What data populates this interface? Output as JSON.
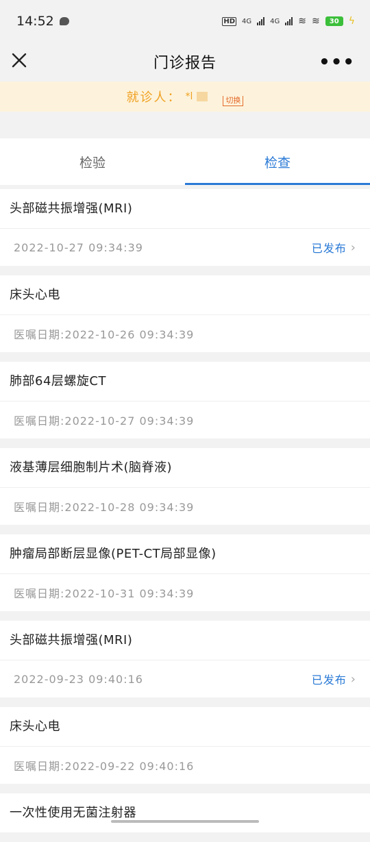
{
  "status_bar": {
    "time": "14:52",
    "hd_label": "HD",
    "net1": "4G",
    "net2": "4G",
    "battery": "30"
  },
  "nav": {
    "title": "门诊报告"
  },
  "patient": {
    "label": "就诊人：",
    "name": "*l",
    "switch_label": "切换"
  },
  "tabs": [
    {
      "label": "检验",
      "active": false
    },
    {
      "label": "检查",
      "active": true
    }
  ],
  "reports": [
    {
      "title": "头部磁共振增强(MRI)",
      "meta": "2022-10-27 09:34:39",
      "status": "已发布"
    },
    {
      "title": "床头心电",
      "meta": "医嘱日期:2022-10-26 09:34:39",
      "status": ""
    },
    {
      "title": "肺部64层螺旋CT",
      "meta": "医嘱日期:2022-10-27 09:34:39",
      "status": ""
    },
    {
      "title": "液基薄层细胞制片术(脑脊液)",
      "meta": "医嘱日期:2022-10-28 09:34:39",
      "status": ""
    },
    {
      "title": "肿瘤局部断层显像(PET-CT局部显像)",
      "meta": "医嘱日期:2022-10-31 09:34:39",
      "status": ""
    },
    {
      "title": "头部磁共振增强(MRI)",
      "meta": "2022-09-23 09:40:16",
      "status": "已发布"
    },
    {
      "title": "床头心电",
      "meta": "医嘱日期:2022-09-22 09:40:16",
      "status": ""
    },
    {
      "title": "一次性使用无菌注射器",
      "meta": "",
      "status": ""
    }
  ],
  "colors": {
    "accent": "#2a7ad6",
    "patient_text": "#f0a020",
    "patient_bg": "#fdf3dc"
  }
}
